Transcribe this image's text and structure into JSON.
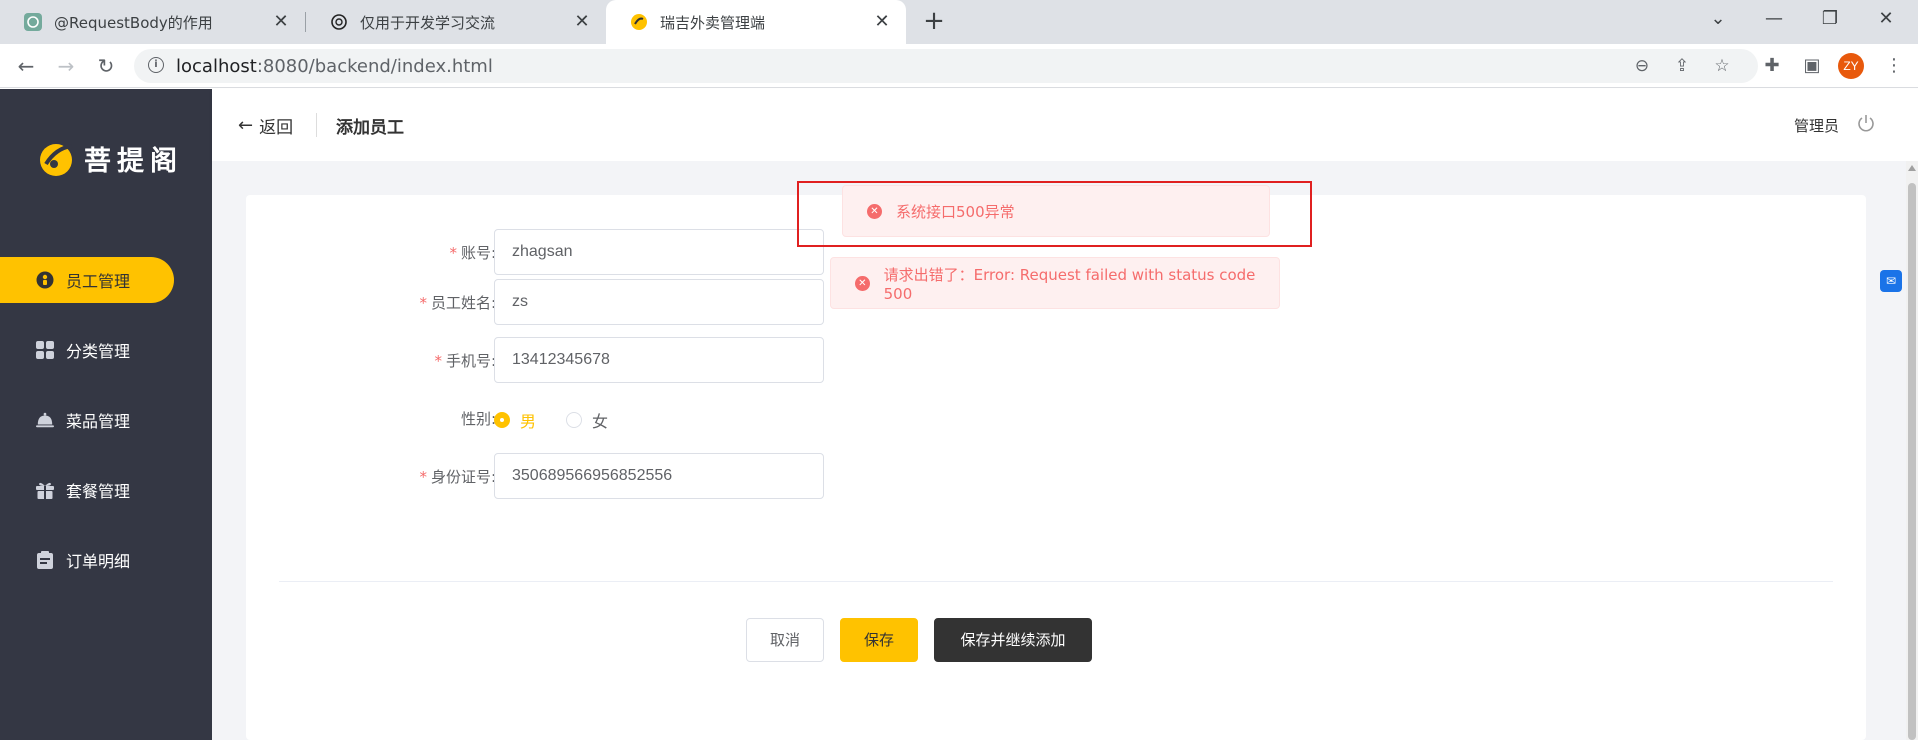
{
  "browser": {
    "tabs": [
      {
        "title": "@RequestBody的作用",
        "icon": "chatgpt-icon"
      },
      {
        "title": "仅用于开发学习交流",
        "icon": "openai-icon"
      },
      {
        "title": "瑞吉外卖管理端",
        "icon": "reggie-logo-icon",
        "active": true
      }
    ],
    "url_host": "localhost",
    "url_path": ":8080/backend/index.html",
    "profile_initials": "ZY"
  },
  "sidebar": {
    "logo_text": "菩提阁",
    "items": [
      {
        "label": "员工管理",
        "icon": "employee-icon",
        "active": true
      },
      {
        "label": "分类管理",
        "icon": "category-grid-icon"
      },
      {
        "label": "菜品管理",
        "icon": "dish-cloche-icon"
      },
      {
        "label": "套餐管理",
        "icon": "gift-icon"
      },
      {
        "label": "订单明细",
        "icon": "clipboard-icon"
      }
    ],
    "accent": "#ffc200",
    "background": "#343744"
  },
  "header": {
    "back_label": "返回",
    "title": "添加员工",
    "user_label": "管理员"
  },
  "form": {
    "account": {
      "label": "账号:",
      "value": "zhagsan",
      "required": true
    },
    "name": {
      "label": "员工姓名:",
      "value": "zs",
      "required": true
    },
    "phone": {
      "label": "手机号:",
      "value": "13412345678",
      "required": true
    },
    "gender": {
      "label": "性别:",
      "options": [
        "男",
        "女"
      ],
      "selected": "男"
    },
    "id_number": {
      "label": "身份证号:",
      "value": "350689566956852556",
      "required": true
    },
    "required_mark": "*"
  },
  "buttons": {
    "cancel": "取消",
    "save": "保存",
    "save_continue": "保存并继续添加"
  },
  "messages": [
    {
      "text": "系统接口500异常",
      "type": "error"
    },
    {
      "text": "请求出错了：Error: Request failed with status code 500",
      "type": "error"
    }
  ]
}
